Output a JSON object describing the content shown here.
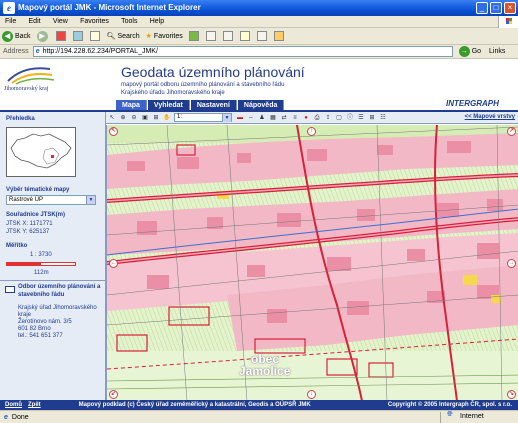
{
  "window": {
    "title": "Mapový portál JMK - Microsoft Internet Explorer",
    "icon_name": "ie-icon"
  },
  "menubar": [
    "File",
    "Edit",
    "View",
    "Favorites",
    "Tools",
    "Help"
  ],
  "toolbar": {
    "back": "Back",
    "search": "Search",
    "favorites": "Favorites"
  },
  "address": {
    "label": "Address",
    "url": "http://194.228.62.234/PORTAL_JMK/",
    "go": "Go",
    "links": "Links"
  },
  "header": {
    "logo_text": "Jihomoravský kraj",
    "title": "Geodata územního plánování",
    "subtitle_1": "mapový portál odboru územního plánování a stavebního řádu",
    "subtitle_2": "Krajského úřadu Jihomoravského kraje",
    "brand": "INTERGRAPH"
  },
  "tabs": [
    {
      "label": "Mapa",
      "active": true
    },
    {
      "label": "Vyhledat",
      "active": false
    },
    {
      "label": "Nastavení",
      "active": false
    },
    {
      "label": "Nápověda",
      "active": false
    }
  ],
  "sidebar": {
    "overview_label": "Přehledka",
    "theme_label": "Výběr tématické mapy",
    "theme_value": "Rastrové ÚP",
    "coords_label": "Souřadnice JTSK(m)",
    "coord_x": "JTSK X:  1171771",
    "coord_y": "JTSK Y:  625137",
    "scale_label": "Měřítko",
    "scale_value": "1 : 3730",
    "scale_length": "112m",
    "contact_title_1": "Odbor územního plánování a",
    "contact_title_2": "stavebního řádu",
    "contact_1": "Krajský úřad Jihomoravského",
    "contact_2": "kraje",
    "contact_3": "Žerotínovo nám. 3/5",
    "contact_4": "601 82 Brno",
    "contact_5": "tel.: 541 651 377"
  },
  "maptoolbar": {
    "scale_value": "1:",
    "layers_link": "<< Mapové vrstvy"
  },
  "map": {
    "place_label_1": "obec",
    "place_label_2": "Jamolice"
  },
  "footer": {
    "home": "Domů",
    "back": "Zpět",
    "credits": "Mapový podklad (c) Český úřad zeměměřický a katastrální, Geodis a OÚPSŘ JMK",
    "copyright": "Copyright © 2005 Intergraph ČR, spol. s r.o."
  },
  "statusbar": {
    "status": "Done",
    "zone": "Internet"
  },
  "colors": {
    "title_blue": "#0a53d6",
    "nav_blue": "#1f3c8f",
    "map_green": "#e1f0c8",
    "built_pink": "#f2b8c6",
    "road_red": "#d8203a"
  }
}
